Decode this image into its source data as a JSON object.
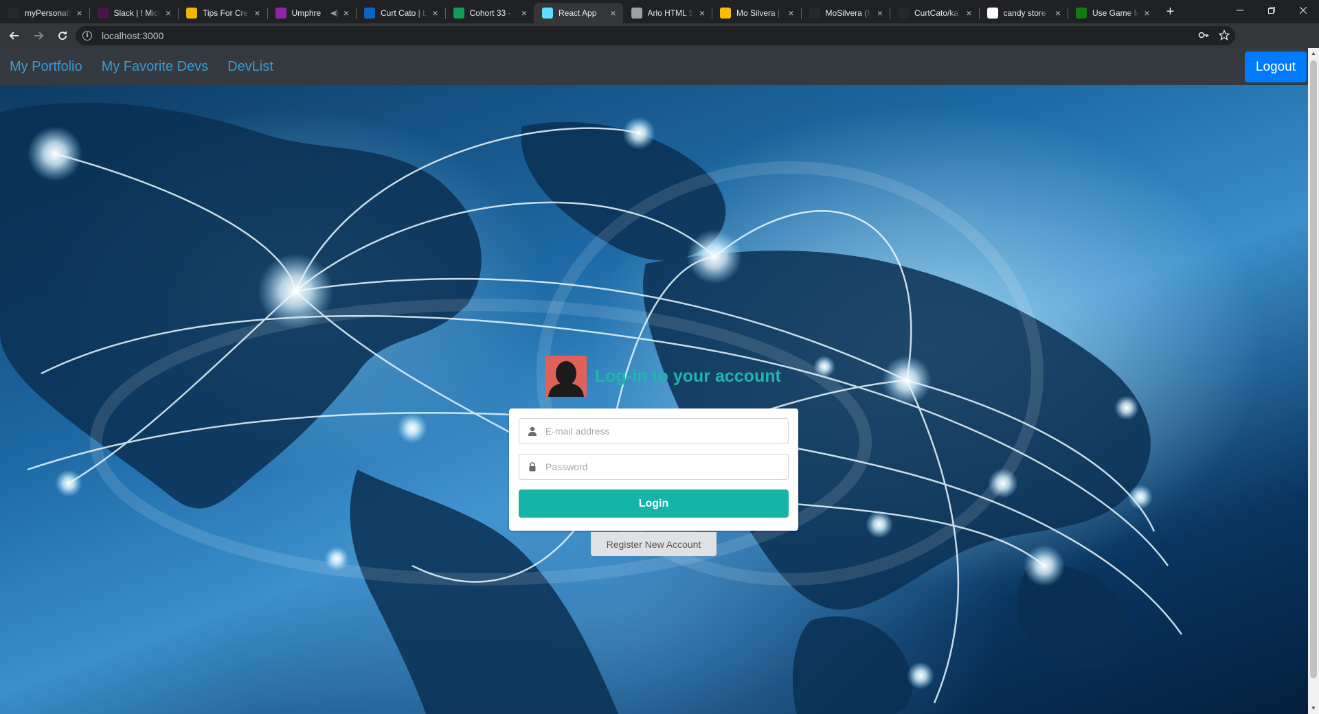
{
  "browser": {
    "tabs": [
      {
        "title": "myPersonalS",
        "favicon": "github-icon",
        "color": "#24292e",
        "active": false
      },
      {
        "title": "Slack | ! Mich",
        "favicon": "slack-icon",
        "color": "#4a154b",
        "active": false
      },
      {
        "title": "Tips For Cre",
        "favicon": "slides-icon",
        "color": "#f4b400",
        "active": false
      },
      {
        "title": "Umphre",
        "favicon": "podcast-icon",
        "color": "#8e24aa",
        "active": false,
        "audio": true
      },
      {
        "title": "Curt Cato | L",
        "favicon": "linkedin-icon",
        "color": "#0a66c2",
        "active": false
      },
      {
        "title": "Cohort 33 -",
        "favicon": "drive-icon",
        "color": "#0f9d58",
        "active": false
      },
      {
        "title": "React App",
        "favicon": "react-icon",
        "color": "#61dafb",
        "active": true
      },
      {
        "title": "Arlo HTML 5",
        "favicon": "globe-icon",
        "color": "#9aa0a6",
        "active": false
      },
      {
        "title": "Mo Silvera |",
        "favicon": "bookmark-icon",
        "color": "#fbbc04",
        "active": false
      },
      {
        "title": "MoSilvera (M",
        "favicon": "github-icon",
        "color": "#24292e",
        "active": false
      },
      {
        "title": "CurtCato/ka",
        "favicon": "github-icon",
        "color": "#24292e",
        "active": false
      },
      {
        "title": "candy store",
        "favicon": "google-icon",
        "color": "#ffffff",
        "active": false
      },
      {
        "title": "Use Game M",
        "favicon": "xbox-icon",
        "color": "#107c10",
        "active": false
      }
    ],
    "new_tab_label": "+",
    "url": "localhost:3000"
  },
  "navbar": {
    "links": [
      "My Portfolio",
      "My Favorite Devs",
      "DevList"
    ],
    "logout_label": "Logout"
  },
  "login": {
    "title": "Log-in to your account",
    "email_placeholder": "E-mail address",
    "password_placeholder": "Password",
    "login_label": "Login",
    "register_label": "Register New Account"
  },
  "colors": {
    "accent": "#16b4a8",
    "link": "#3a9bd9",
    "logout": "#007bff"
  }
}
